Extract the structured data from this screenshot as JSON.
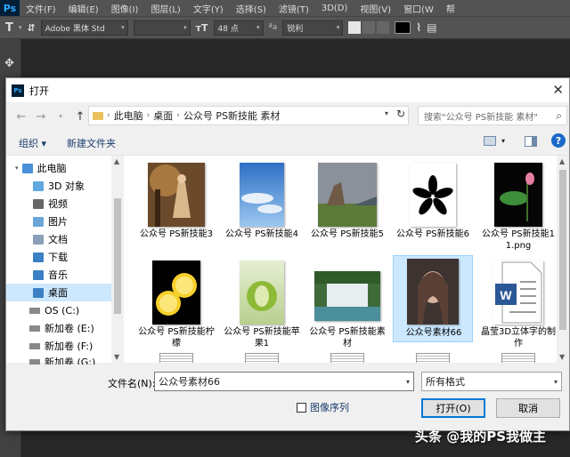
{
  "ps": {
    "logo": "Ps",
    "menu": [
      "文件(F)",
      "编辑(E)",
      "图像(I)",
      "图层(L)",
      "文字(Y)",
      "选择(S)",
      "滤镜(T)",
      "3D(D)",
      "视图(V)",
      "窗口(W",
      "帮"
    ],
    "options": {
      "tool_glyph": "T",
      "font_family": "Adobe 黑体 Std",
      "font_size": "48 点",
      "antialias_prefix": "ªa",
      "antialias": "锐利"
    }
  },
  "dialog": {
    "title": "打开",
    "close": "✕",
    "breadcrumb": [
      "此电脑",
      "桌面",
      "公众号 PS新技能 素材"
    ],
    "search_placeholder": "搜索\"公众号 PS新技能 素材\"",
    "organize": "组织 ▾",
    "new_folder": "新建文件夹",
    "help": "?",
    "nav_items": [
      {
        "label": "此电脑",
        "icon": "computer-icon",
        "color": "#4a90d9"
      },
      {
        "label": "3D 对象",
        "icon": "cube-icon",
        "color": "#5fa8e0"
      },
      {
        "label": "视频",
        "icon": "video-icon",
        "color": "#666"
      },
      {
        "label": "图片",
        "icon": "pictures-icon",
        "color": "#6aa6d8"
      },
      {
        "label": "文档",
        "icon": "documents-icon",
        "color": "#8aa0b8"
      },
      {
        "label": "下载",
        "icon": "download-icon",
        "color": "#3b7fc4"
      },
      {
        "label": "音乐",
        "icon": "music-icon",
        "color": "#3b7fc4"
      },
      {
        "label": "桌面",
        "icon": "desktop-icon",
        "color": "#3b7fc4"
      },
      {
        "label": "OS (C:)",
        "icon": "drive-icon",
        "color": "#888"
      },
      {
        "label": "新加卷 (E:)",
        "icon": "drive-icon",
        "color": "#888"
      },
      {
        "label": "新加卷 (F:)",
        "icon": "drive-icon",
        "color": "#888"
      },
      {
        "label": "新加卷 (G:)",
        "icon": "drive-icon",
        "color": "#888"
      }
    ],
    "files": [
      {
        "label": "公众号 PS新技能3",
        "thumb": "fairy-forest-thumb"
      },
      {
        "label": "公众号 PS新技能4",
        "thumb": "blue-sky-thumb"
      },
      {
        "label": "公众号 PS新技能5",
        "thumb": "rock-landscape-thumb"
      },
      {
        "label": "公众号 PS新技能6",
        "thumb": "black-flower-thumb"
      },
      {
        "label": "公众号 PS新技能11.png",
        "thumb": "lotus-thumb"
      },
      {
        "label": "公众号 PS新技能柠檬",
        "thumb": "lemon-thumb"
      },
      {
        "label": "公众号 PS新技能苹果1",
        "thumb": "green-apple-thumb"
      },
      {
        "label": "公众号 PS新技能素材",
        "thumb": "waterfall-thumb"
      },
      {
        "label": "公众号素材66",
        "thumb": "portrait-thumb"
      },
      {
        "label": "晶莹3D立体字的制作",
        "thumb": "word-doc-thumb"
      }
    ],
    "filename_label": "文件名(N):",
    "filename_value": "公众号素材66",
    "format": "所有格式",
    "image_sequence": "图像序列",
    "open_button": "打开(O)",
    "cancel_button": "取消"
  },
  "watermark": "头条 @我的PS我做主"
}
